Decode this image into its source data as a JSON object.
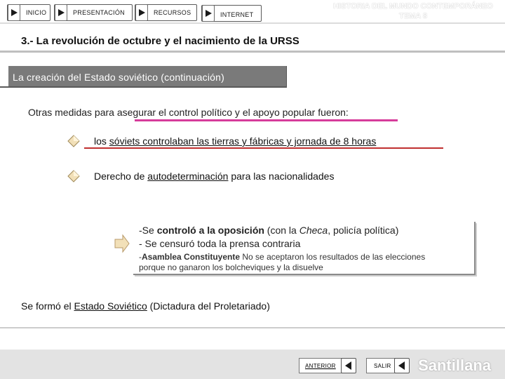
{
  "nav": {
    "inicio": "INICIO",
    "presentacion": "PRESENTACIÓN",
    "recursos": "RECURSOS",
    "internet": "INTERNET"
  },
  "header": {
    "line1": "HISTORIA DEL MUNDO CONTEMPORÁNEO",
    "line2": "TEMA 8"
  },
  "main_title": "3.- La revolución de octubre y el nacimiento de la URSS",
  "section_title": "La creación del Estado soviético (continuación)",
  "intro": "Otras medidas para asegurar el control político y el apoyo popular fueron:",
  "bullets": [
    {
      "pre": "los ",
      "underlined": "sóviets controlaban las tierras y fábricas y jornada de 8 horas",
      "post": ""
    },
    {
      "pre": "Derecho de ",
      "underlined": "autodeterminación",
      "post": " para las nacionalidades"
    }
  ],
  "box": {
    "line1_a": "-Se ",
    "line1_b": "controló a la oposición",
    "line1_c": " (con la ",
    "line1_d": "Checa",
    "line1_e": ", policía política)",
    "line2": "- Se censuró toda la prensa contraria",
    "line3_a": "-",
    "line3_b": "Asamblea Constituyente",
    "line3_c": " No se aceptaron los resultados de las elecciones",
    "line4": "porque no ganaron los bolcheviques y la disuelve"
  },
  "formed": {
    "pre": "Se formó el ",
    "underlined": "Estado Soviético",
    "post": " (Dictadura del Proletariado)"
  },
  "footer": {
    "anterior": "ANTERIOR",
    "salir": "SALIR",
    "brand": "Santillana"
  }
}
